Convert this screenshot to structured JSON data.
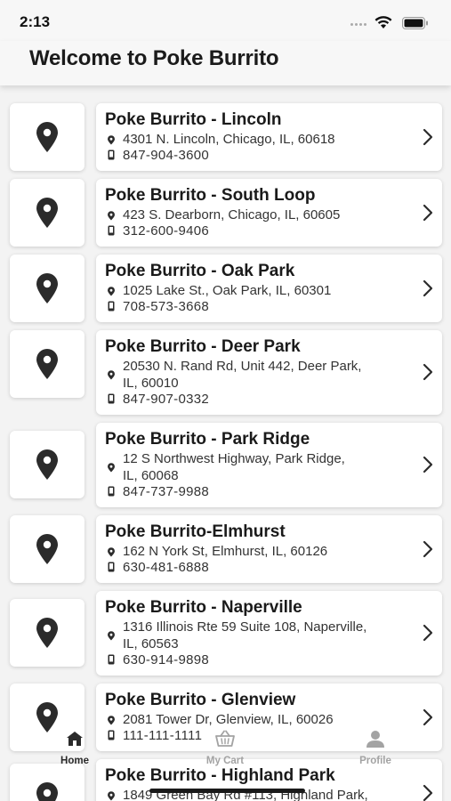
{
  "status_bar": {
    "time": "2:13"
  },
  "header": {
    "title": "Welcome to Poke Burrito"
  },
  "locations": [
    {
      "name": "Poke Burrito - Lincoln",
      "address": "4301 N. Lincoln, Chicago, IL, 60618",
      "address2": "",
      "phone": "847-904-3600"
    },
    {
      "name": "Poke Burrito - South Loop",
      "address": "423 S. Dearborn, Chicago, IL, 60605",
      "address2": "",
      "phone": "312-600-9406"
    },
    {
      "name": "Poke Burrito - Oak Park",
      "address": "1025 Lake St., Oak Park, IL, 60301",
      "address2": "",
      "phone": "708-573-3668"
    },
    {
      "name": "Poke Burrito - Deer Park",
      "address": "20530 N. Rand Rd, Unit 442, Deer Park,",
      "address2": "IL, 60010",
      "phone": "847-907-0332"
    },
    {
      "name": "Poke Burrito - Park Ridge",
      "address": "12 S Northwest Highway, Park Ridge,",
      "address2": "IL, 60068",
      "phone": "847-737-9988"
    },
    {
      "name": "Poke Burrito-Elmhurst",
      "address": "162 N York St, Elmhurst, IL, 60126",
      "address2": "",
      "phone": "630-481-6888"
    },
    {
      "name": "Poke Burrito - Naperville",
      "address": "1316 Illinois Rte 59 Suite 108, Naperville,",
      "address2": "IL, 60563",
      "phone": "630-914-9898"
    },
    {
      "name": "Poke Burrito - Glenview",
      "address": "2081 Tower Dr, Glenview, IL, 60026",
      "address2": "",
      "phone": "111-111-1111"
    },
    {
      "name": "Poke Burrito - Highland Park",
      "address": "1849 Green Bay Rd #113, Highland Park,",
      "address2": "",
      "phone": ""
    }
  ],
  "tabbar": {
    "home": "Home",
    "cart": "My Cart",
    "profile": "Profile"
  },
  "colors": {
    "background": "#f3f3f3",
    "card": "#ffffff",
    "text": "#1a1a1a",
    "tab_inactive": "#a3a3a3",
    "icon": "#2b2b2b"
  }
}
